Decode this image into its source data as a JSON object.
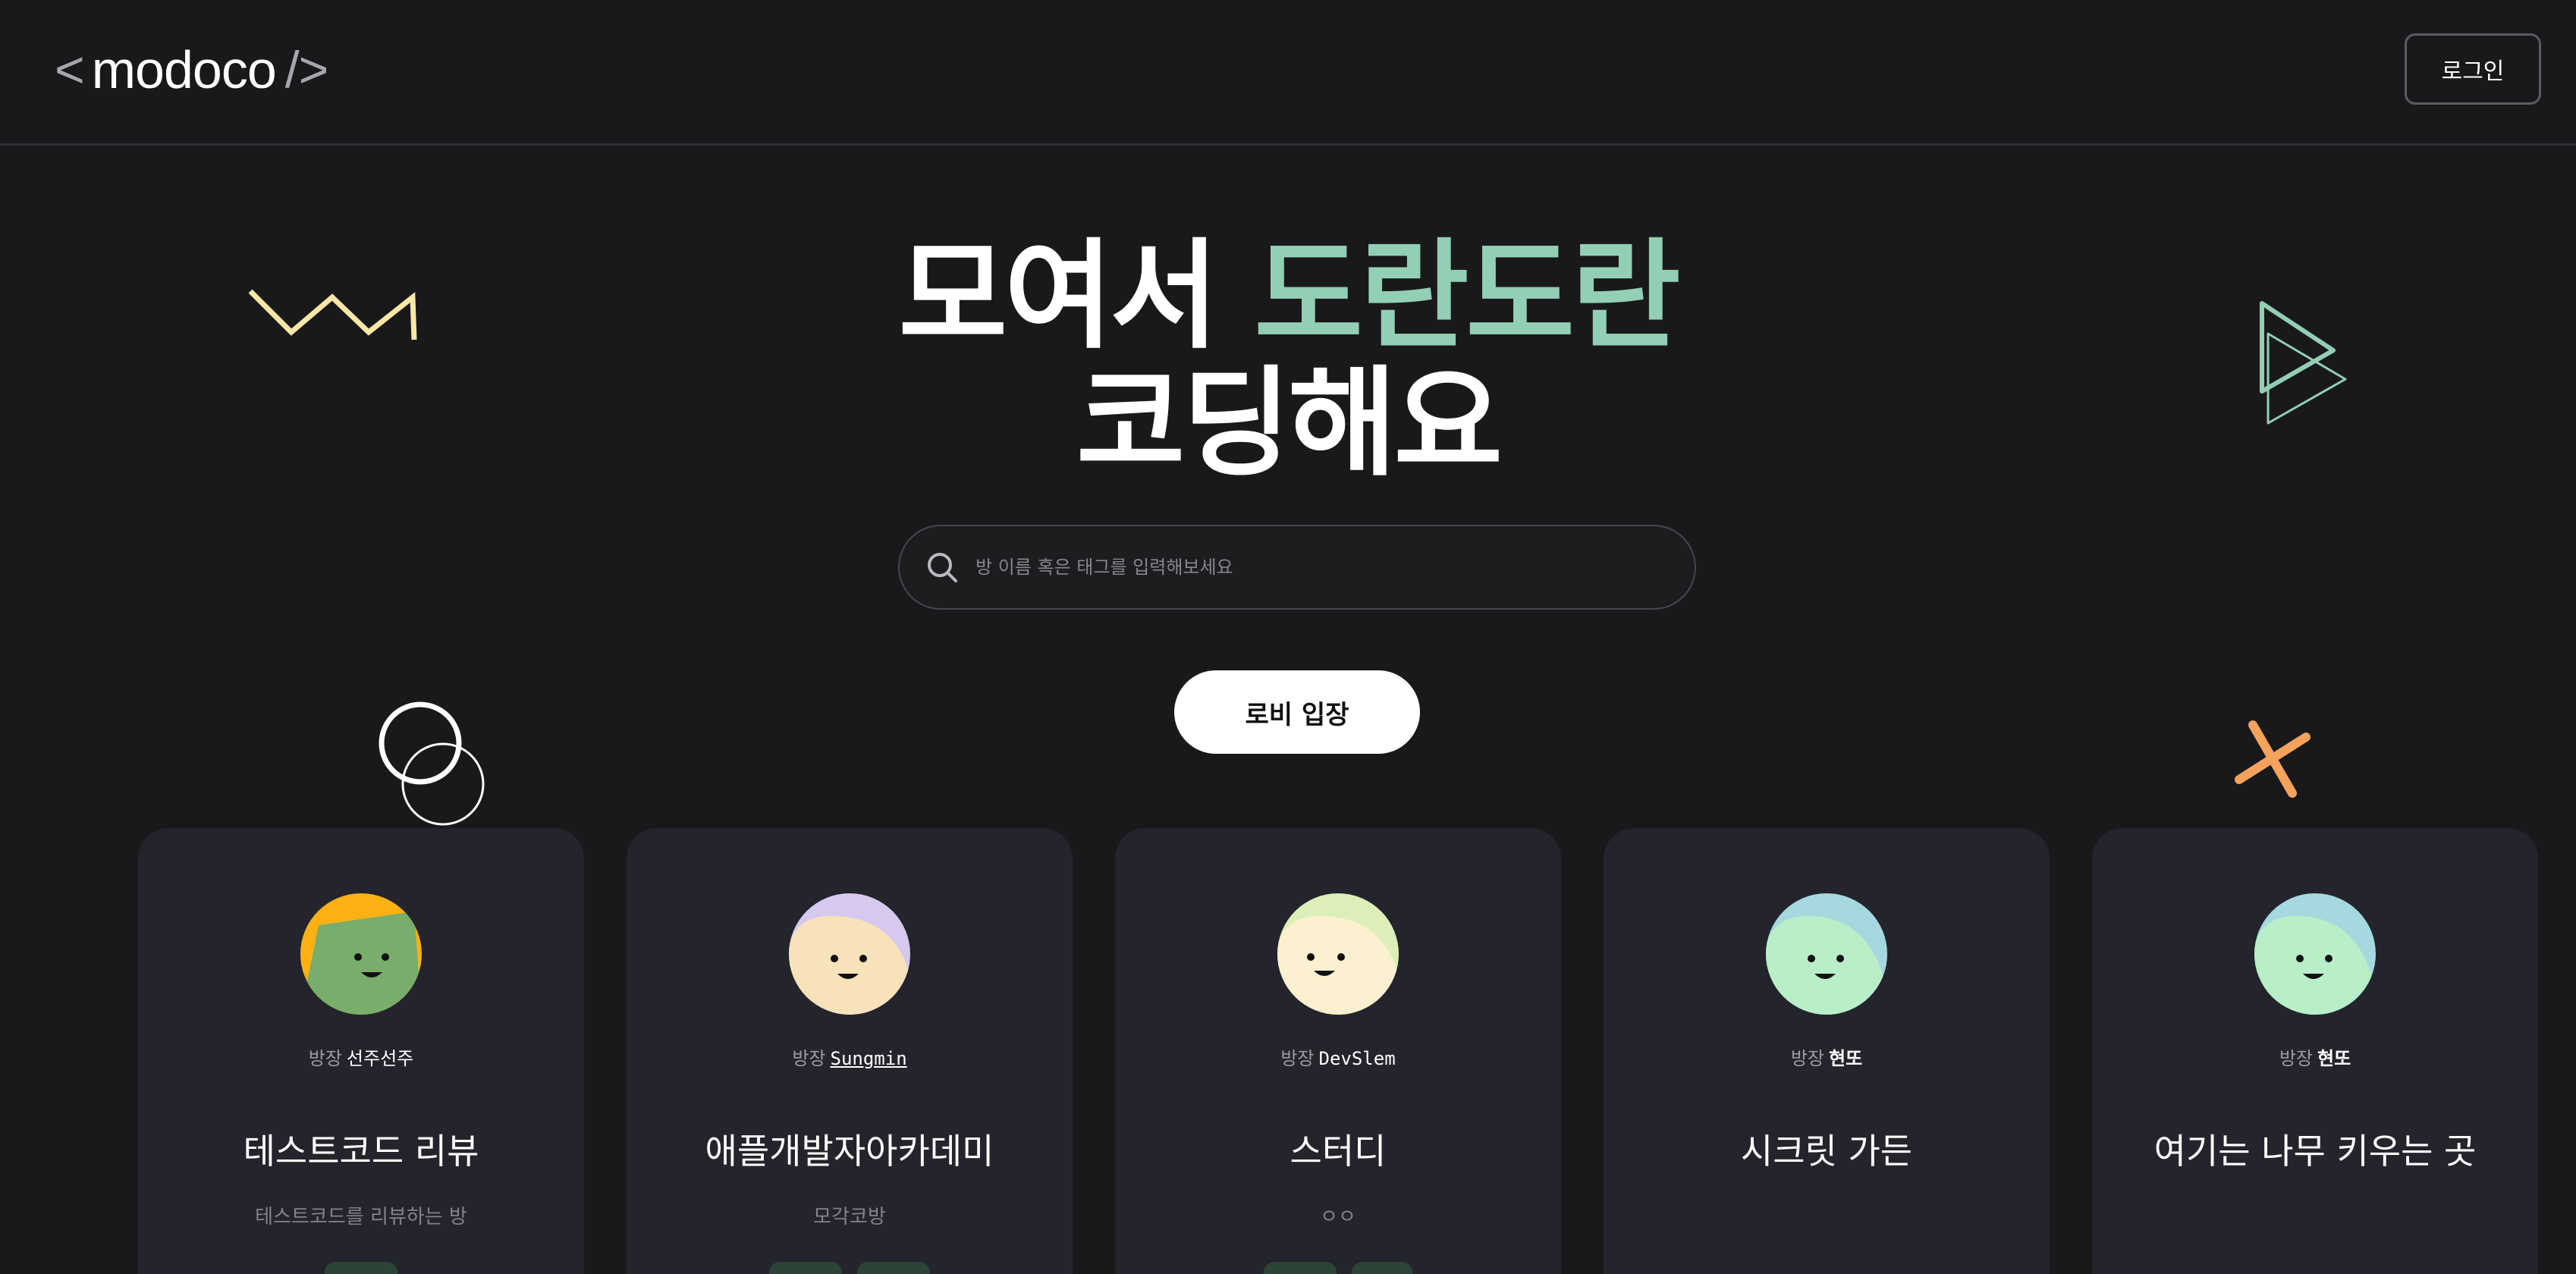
{
  "header": {
    "logo": {
      "lt": "<",
      "word": "modoco",
      "gt": "/>"
    },
    "login_label": "로그인"
  },
  "hero": {
    "line1_a": "모여서 ",
    "line1_b": "도란도란",
    "line2": "코딩해요"
  },
  "search": {
    "icon": "search-icon",
    "placeholder": "방 이름 혹은 태그를 입력해보세요"
  },
  "lobby_label": "로비 입장",
  "owner_prefix": "방장",
  "colors": {
    "background": "#19191b",
    "card": "#23242c",
    "accent_green": "#93cfb4",
    "zigzag_yellow": "#fbe7a6",
    "cross_orange": "#f5a25d"
  },
  "cards": [
    {
      "owner": "선주선주",
      "title": "테스트코드 리뷰",
      "desc": "테스트코드를 리뷰하는 방",
      "avatar": "green-square-face-avatar"
    },
    {
      "owner": "Sungmin",
      "title": "애플개발자아카데미",
      "desc": "모각코방",
      "avatar": "lavender-cream-face-avatar"
    },
    {
      "owner": "DevSlem",
      "title": "스터디",
      "desc": "ㅇㅇ",
      "avatar": "lime-cream-face-avatar"
    },
    {
      "owner": "현또",
      "title": "시크릿 가든",
      "desc": "",
      "avatar": "blue-mint-face-avatar"
    },
    {
      "owner": "현또",
      "title": "여기는 나무 키우는 곳",
      "desc": "",
      "avatar": "blue-mint-face-avatar"
    }
  ]
}
